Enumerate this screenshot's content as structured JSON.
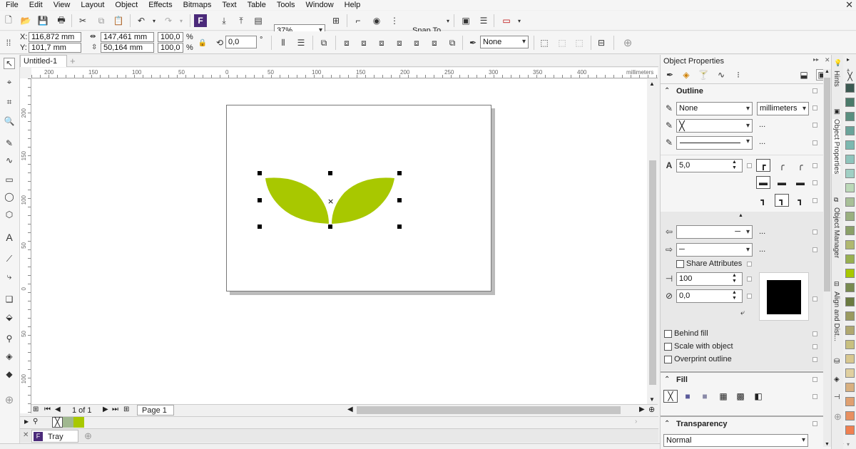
{
  "menu": [
    "File",
    "Edit",
    "View",
    "Layout",
    "Object",
    "Effects",
    "Bitmaps",
    "Text",
    "Table",
    "Tools",
    "Window",
    "Help"
  ],
  "toolbar": {
    "zoom": "37%",
    "snap_to": "Snap To"
  },
  "property_bar": {
    "x": "116,872 mm",
    "y": "101,7 mm",
    "width": "147,461 mm",
    "height": "50,164 mm",
    "scale_w": "100,0",
    "scale_h": "100,0",
    "pct": "%",
    "rotation": "0,0",
    "degree": "°",
    "outline": "None"
  },
  "document": {
    "tab_title": "Untitled-1",
    "page_counter": "1 of 1",
    "page_tab": "Page 1",
    "ruler_unit": "millimeters",
    "hruler_labels": [
      "200",
      "150",
      "100",
      "50",
      "0",
      "50",
      "100",
      "150",
      "200",
      "250",
      "300",
      "350",
      "400"
    ],
    "vruler_labels": [
      "200",
      "150",
      "100",
      "50",
      "0",
      "50",
      "100"
    ]
  },
  "tray": {
    "label": "Tray"
  },
  "panel": {
    "title": "Object Properties",
    "outline": {
      "header": "Outline",
      "width": "None",
      "units": "millimeters",
      "miter": "5,0",
      "share_attributes": "Share Attributes",
      "stretch": "100",
      "angle": "0,0",
      "behind_fill": "Behind fill",
      "scale_with_object": "Scale with object",
      "overprint_outline": "Overprint outline",
      "color": "#000000"
    },
    "fill": {
      "header": "Fill"
    },
    "transparency": {
      "header": "Transparency",
      "mode": "Normal"
    }
  },
  "side_tabs": [
    "Hints",
    "Object Properties",
    "Object Manager",
    "Align and Dist..."
  ],
  "colors": {
    "leaf": "#a8c800",
    "palette": [
      "#3c5a52",
      "#4a7a6a",
      "#5a8f80",
      "#6aa39a",
      "#7cb8b0",
      "#8fc4bc",
      "#a0cfc4",
      "#bcd8b8",
      "#a8c098",
      "#9ab080",
      "#8aa068",
      "#b0b870",
      "#98b050",
      "#a8c800",
      "#788a50",
      "#6a7a40",
      "#9a9a60",
      "#b0a870",
      "#c8c080",
      "#d8c890",
      "#e0d0a0",
      "#d8b080",
      "#e0a070",
      "#e89060",
      "#f08050"
    ]
  }
}
